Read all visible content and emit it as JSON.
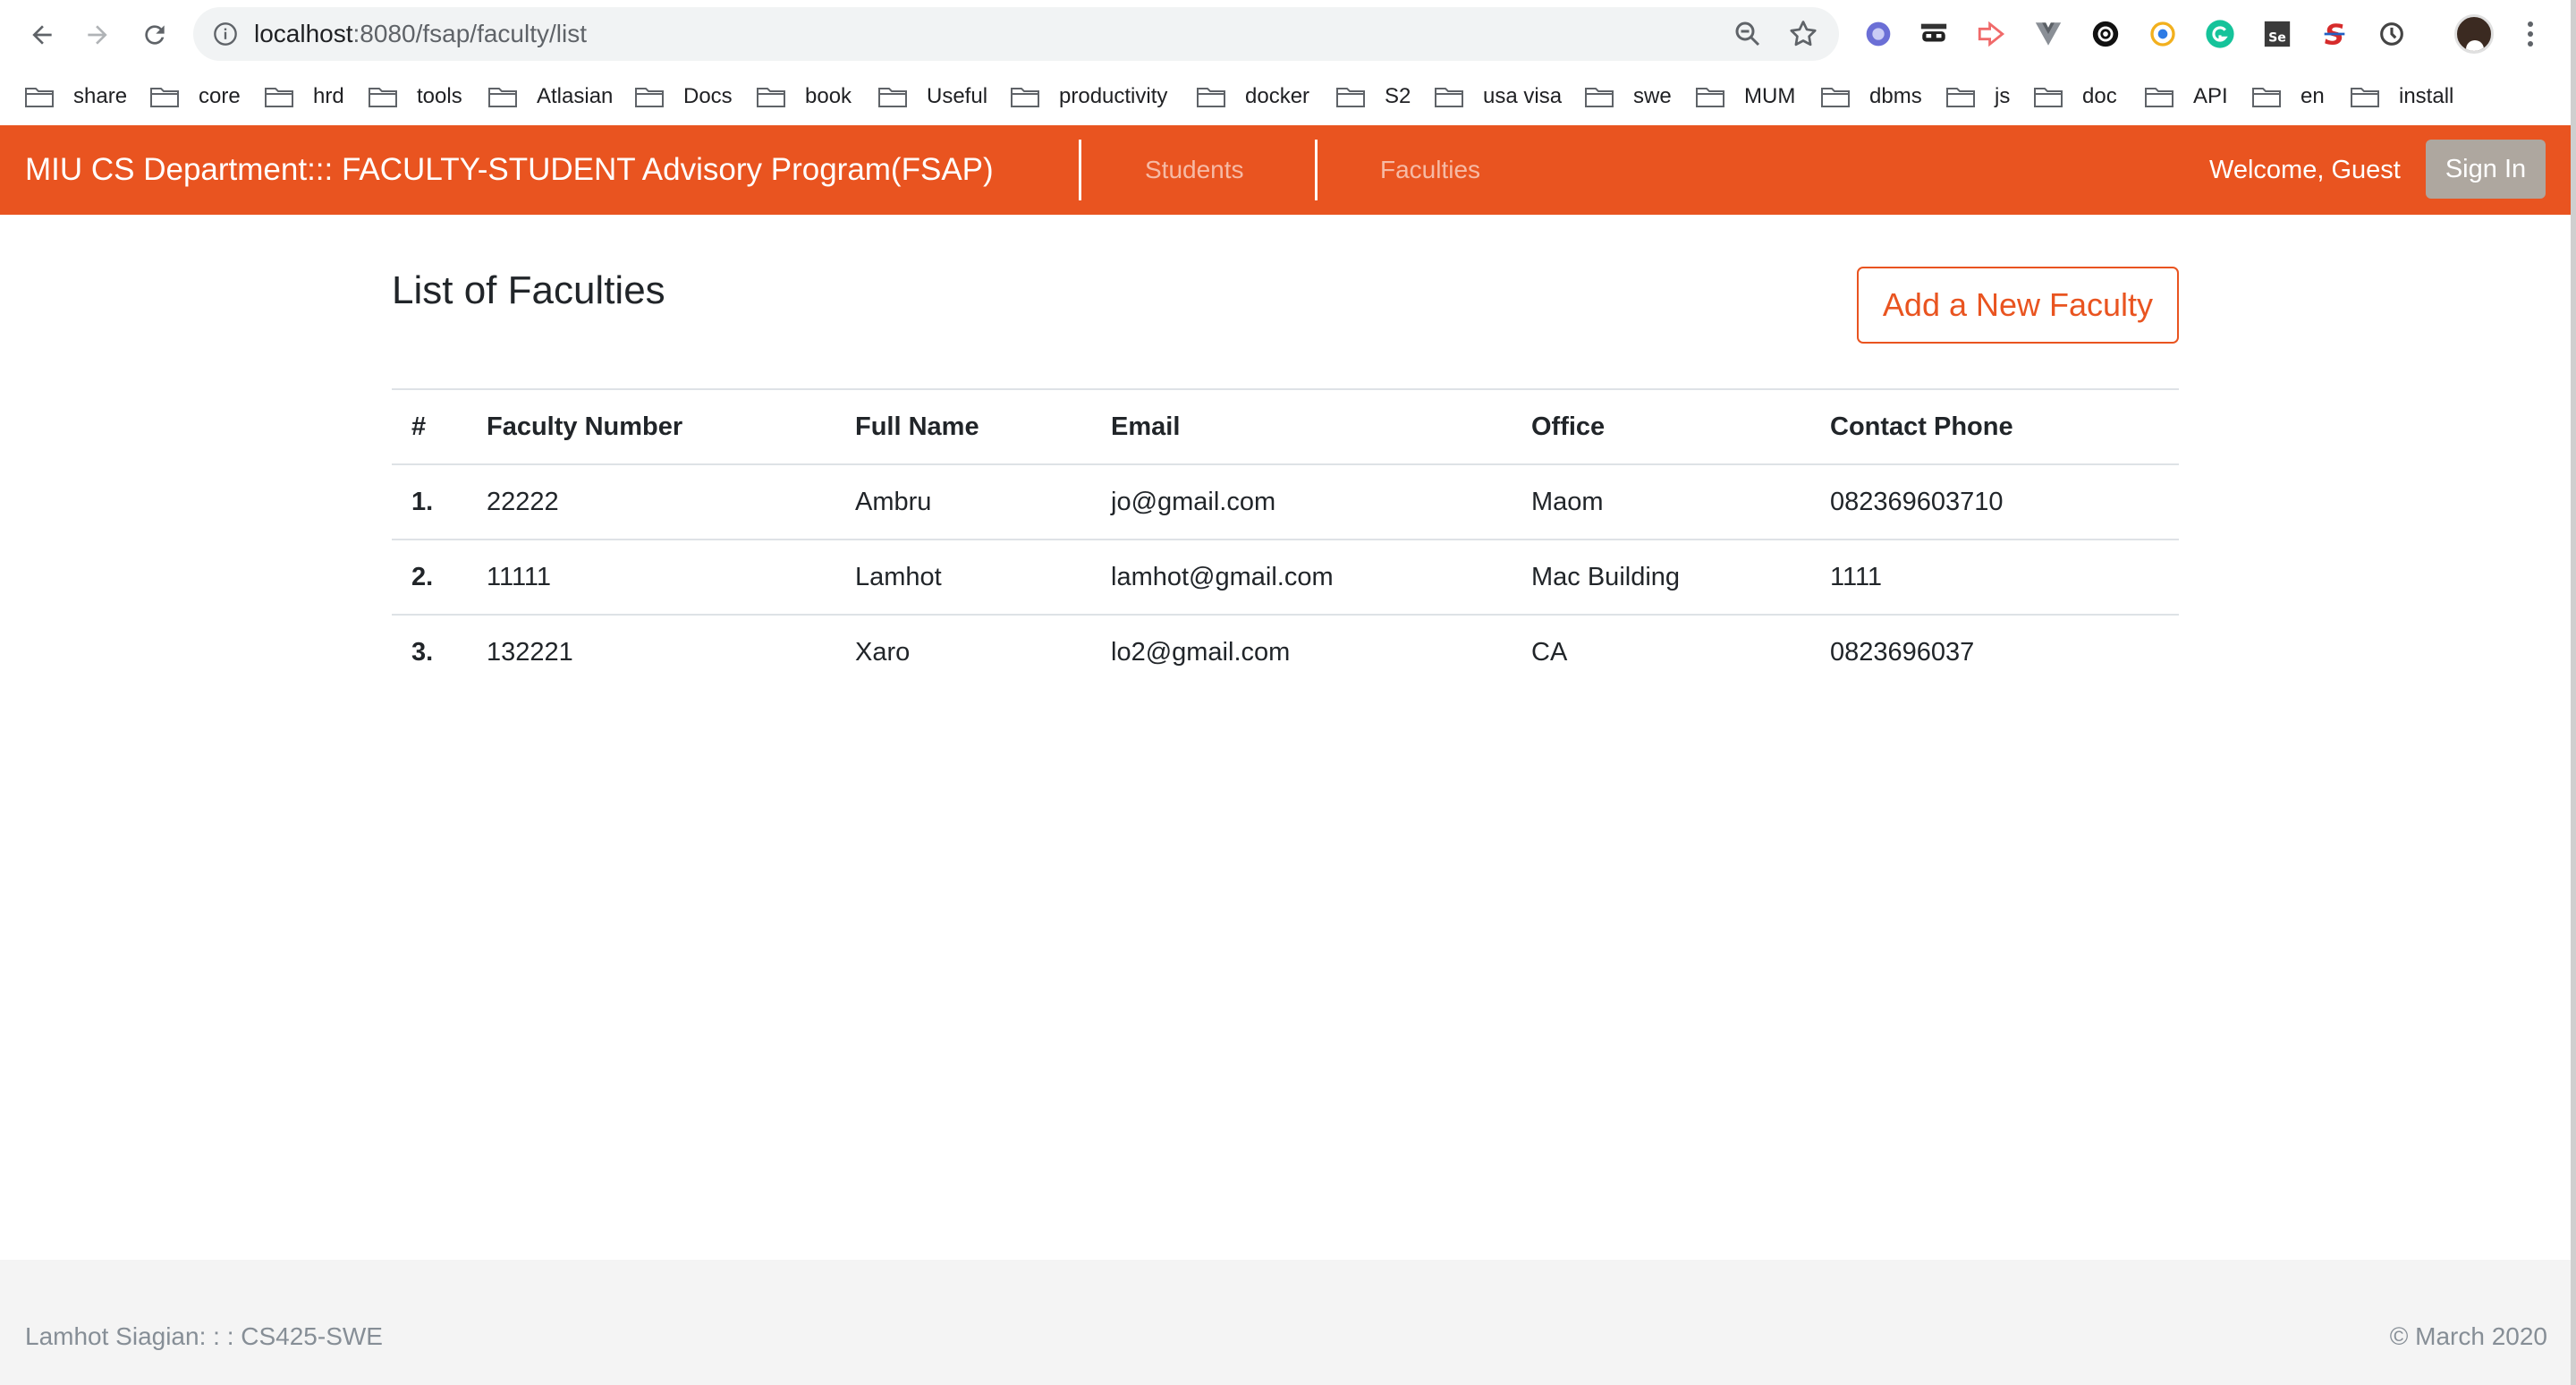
{
  "browser": {
    "url_host": "localhost",
    "url_path": ":8080/fsap/faculty/list",
    "bookmarks": [
      "share",
      "core",
      "hrd",
      "tools",
      "Atlasian",
      "Docs",
      "book",
      "Useful",
      "productivity",
      "docker",
      "S2",
      "usa visa",
      "swe",
      "MUM",
      "dbms",
      "js",
      "doc",
      "API",
      "en",
      "install"
    ]
  },
  "navbar": {
    "brand": "MIU CS Department::: FACULTY-STUDENT Advisory Program(FSAP)",
    "links": [
      "Students",
      "Faculties"
    ],
    "welcome": "Welcome, Guest",
    "signin_label": "Sign In",
    "color": "#e95420"
  },
  "main": {
    "title": "List of Faculties",
    "add_button_label": "Add a New Faculty",
    "table": {
      "headers": [
        "#",
        "Faculty Number",
        "Full Name",
        "Email",
        "Office",
        "Contact Phone"
      ],
      "rows": [
        [
          "1.",
          "22222",
          "Ambru",
          "jo@gmail.com",
          "Maom",
          "082369603710"
        ],
        [
          "2.",
          "11111",
          "Lamhot",
          "lamhot@gmail.com",
          "Mac Building",
          "1111"
        ],
        [
          "3.",
          "132221",
          "Xaro",
          "lo2@gmail.com",
          "CA",
          "0823696037"
        ]
      ]
    }
  },
  "footer": {
    "left": "Lamhot Siagian: : : CS425-SWE",
    "right": "© March 2020"
  }
}
